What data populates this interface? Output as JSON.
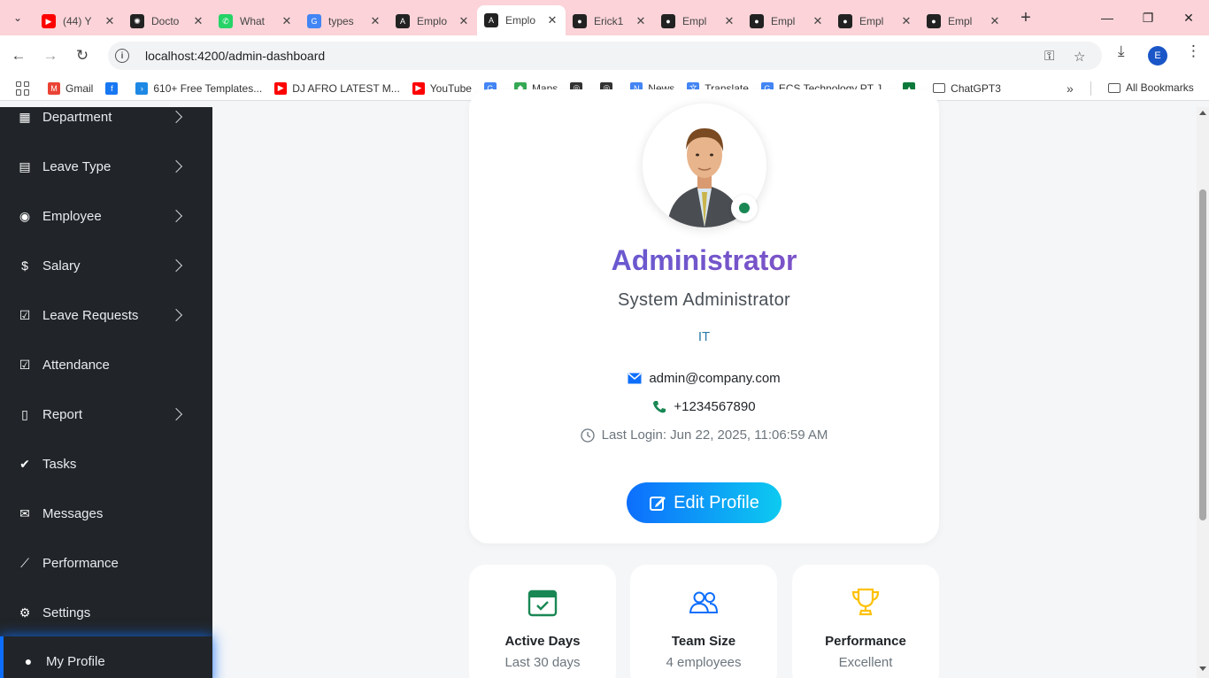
{
  "browser": {
    "tabs": [
      {
        "title": "(44) Y",
        "favicon": "youtube-icon",
        "color": "#ff0000"
      },
      {
        "title": "Docto",
        "favicon": "openai-icon",
        "color": "#222222"
      },
      {
        "title": "What",
        "favicon": "whatsapp-icon",
        "color": "#25d366"
      },
      {
        "title": "types",
        "favicon": "google-icon",
        "color": "#4285f4"
      },
      {
        "title": "Emplo",
        "favicon": "angular-icon",
        "color": "#222222"
      },
      {
        "title": "Emplo",
        "favicon": "angular-icon",
        "color": "#222222"
      },
      {
        "title": "Erick1",
        "favicon": "github-icon",
        "color": "#222222"
      },
      {
        "title": "Empl",
        "favicon": "github-icon",
        "color": "#222222"
      },
      {
        "title": "Empl",
        "favicon": "github-icon",
        "color": "#222222"
      },
      {
        "title": "Empl",
        "favicon": "github-icon",
        "color": "#222222"
      },
      {
        "title": "Empl",
        "favicon": "github-icon",
        "color": "#222222"
      }
    ],
    "active_tab_index": 5,
    "address": "localhost:4200/admin-dashboard",
    "profile_initial": "E",
    "bookmarks": [
      {
        "label": "Gmail",
        "icon": "gmail-icon",
        "color": "#ea4335"
      },
      {
        "label": "",
        "icon": "facebook-icon",
        "color": "#1877f2"
      },
      {
        "label": "610+ Free Templates...",
        "icon": "template-icon",
        "color": "#1e88e5"
      },
      {
        "label": "DJ AFRO LATEST M...",
        "icon": "youtube-icon",
        "color": "#ff0000"
      },
      {
        "label": "YouTube",
        "icon": "youtube-icon",
        "color": "#ff0000"
      },
      {
        "label": "",
        "icon": "google-icon",
        "color": "#4285f4"
      },
      {
        "label": "Maps",
        "icon": "maps-icon",
        "color": "#34a853"
      },
      {
        "label": "",
        "icon": "globe-icon",
        "color": "#333333"
      },
      {
        "label": "",
        "icon": "globe-icon",
        "color": "#333333"
      },
      {
        "label": "News",
        "icon": "news-icon",
        "color": "#4285f4"
      },
      {
        "label": "Translate",
        "icon": "translate-icon",
        "color": "#4285f4"
      },
      {
        "label": "ECS Technology PT J...",
        "icon": "google-icon",
        "color": "#4285f4"
      },
      {
        "label": "",
        "icon": "tree-icon",
        "color": "#0b7a3b"
      },
      {
        "label": "ChatGPT3",
        "icon": "folder-icon",
        "color": "#555555"
      }
    ],
    "all_bookmarks": "All Bookmarks",
    "more": "»"
  },
  "sidebar": {
    "items": [
      {
        "label": "Department",
        "icon": "building-icon",
        "chevron": true
      },
      {
        "label": "Leave Type",
        "icon": "calendar-list-icon",
        "chevron": true
      },
      {
        "label": "Employee",
        "icon": "user-circle-icon",
        "chevron": true
      },
      {
        "label": "Salary",
        "icon": "dollar-icon",
        "chevron": true
      },
      {
        "label": "Leave Requests",
        "icon": "calendar-check-icon",
        "chevron": true
      },
      {
        "label": "Attendance",
        "icon": "calendar-check-icon",
        "chevron": false
      },
      {
        "label": "Report",
        "icon": "file-icon",
        "chevron": true
      },
      {
        "label": "Tasks",
        "icon": "check-circle-icon",
        "chevron": false
      },
      {
        "label": "Messages",
        "icon": "chat-icon",
        "chevron": false
      },
      {
        "label": "Performance",
        "icon": "chart-line-icon",
        "chevron": false
      },
      {
        "label": "Settings",
        "icon": "gear-icon",
        "chevron": false
      },
      {
        "label": "My Profile",
        "icon": "person-icon",
        "chevron": false,
        "active": true
      }
    ]
  },
  "profile": {
    "name": "Administrator",
    "role": "System Administrator",
    "department": "IT",
    "email": "admin@company.com",
    "phone": "+1234567890",
    "last_login": "Last Login: Jun 22, 2025, 11:06:59 AM",
    "edit_button": "Edit Profile",
    "status": "online"
  },
  "stats": [
    {
      "title": "Active Days",
      "subtitle": "Last 30 days",
      "icon": "calendar-check-icon",
      "color": "#198754"
    },
    {
      "title": "Team Size",
      "subtitle": "4 employees",
      "icon": "people-icon",
      "color": "#0d6efd"
    },
    {
      "title": "Performance",
      "subtitle": "Excellent",
      "icon": "trophy-icon",
      "color": "#ffc107"
    }
  ]
}
